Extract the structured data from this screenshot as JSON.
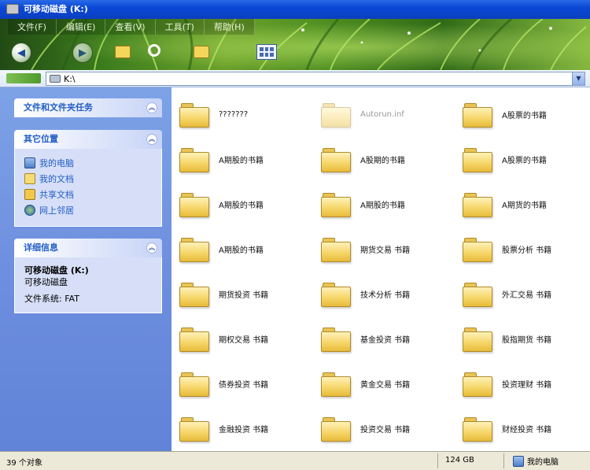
{
  "window": {
    "title": "可移动磁盘 (K:)"
  },
  "menu": [
    "文件(F)",
    "编辑(E)",
    "查看(V)",
    "工具(T)",
    "帮助(H)"
  ],
  "toolbar": {
    "buttons": [
      "back-icon",
      "forward-icon",
      "up-folder-icon",
      "search-icon",
      "folders-icon",
      "views-icon"
    ]
  },
  "address": {
    "value": "K:\\"
  },
  "panels": {
    "tasks": {
      "title": "文件和文件夹任务"
    },
    "other": {
      "title": "其它位置",
      "links": [
        "我的电脑",
        "我的文档",
        "共享文档",
        "网上邻居"
      ]
    },
    "details": {
      "title": "详细信息",
      "name": "可移动磁盘 (K:)",
      "type": "可移动磁盘",
      "filesystem": "文件系统: FAT"
    }
  },
  "files": [
    {
      "name": "???????",
      "faded": false
    },
    {
      "name": "Autorun.inf",
      "faded": true
    },
    {
      "name": "A股票的书籍",
      "faded": false
    },
    {
      "name": "A期股的书籍",
      "faded": false
    },
    {
      "name": "A股期的书籍",
      "faded": false
    },
    {
      "name": "A股票的书籍",
      "faded": false
    },
    {
      "name": "A期股的书籍",
      "faded": false
    },
    {
      "name": "A期股的书籍",
      "faded": false
    },
    {
      "name": "A期货的书籍",
      "faded": false
    },
    {
      "name": "A期股的书籍",
      "faded": false
    },
    {
      "name": "期货交易 书籍",
      "faded": false
    },
    {
      "name": "股票分析 书籍",
      "faded": false
    },
    {
      "name": "期货投资 书籍",
      "faded": false
    },
    {
      "name": "技术分析 书籍",
      "faded": false
    },
    {
      "name": "外汇交易 书籍",
      "faded": false
    },
    {
      "name": "期权交易 书籍",
      "faded": false
    },
    {
      "name": "基金投资 书籍",
      "faded": false
    },
    {
      "name": "股指期货 书籍",
      "faded": false
    },
    {
      "name": "债券投资 书籍",
      "faded": false
    },
    {
      "name": "黄金交易 书籍",
      "faded": false
    },
    {
      "name": "投资理财 书籍",
      "faded": false
    },
    {
      "name": "金融投资 书籍",
      "faded": false
    },
    {
      "name": "投资交易 书籍",
      "faded": false
    },
    {
      "name": "财经投资 书籍",
      "faded": false
    }
  ],
  "status": {
    "count": "39 个对象",
    "size": "124 GB",
    "zone": "我的电脑"
  }
}
